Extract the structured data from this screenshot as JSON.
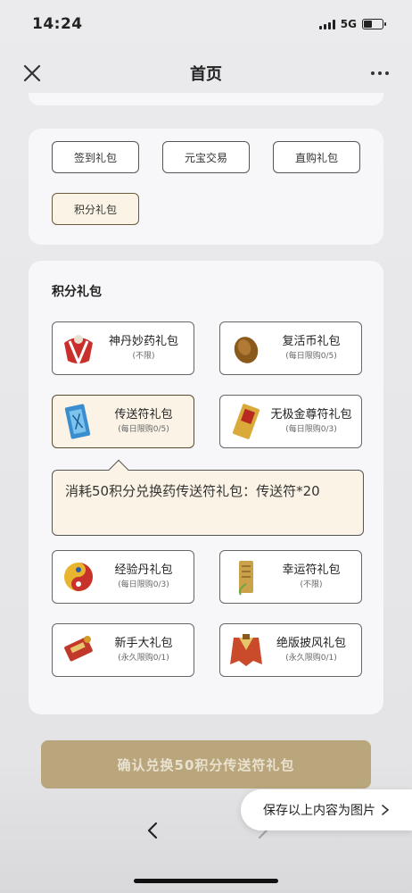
{
  "status_bar": {
    "time": "14:24",
    "network": "5G"
  },
  "nav": {
    "title": "首页"
  },
  "tabs": [
    {
      "label": "签到礼包",
      "active": false
    },
    {
      "label": "元宝交易",
      "active": false
    },
    {
      "label": "直购礼包",
      "active": false
    },
    {
      "label": "积分礼包",
      "active": true
    }
  ],
  "section": {
    "title": "积分礼包"
  },
  "gifts": [
    {
      "name": "神丹妙药礼包",
      "limit": "(不限)",
      "icon": "red-pill-package-icon"
    },
    {
      "name": "复活币礼包",
      "limit": "(每日限购0/5)",
      "icon": "revive-coin-icon"
    },
    {
      "name": "传送符礼包",
      "limit": "(每日限购0/5)",
      "icon": "teleport-charm-icon",
      "selected": true
    },
    {
      "name": "无极金尊符礼包",
      "limit": "(每日限购0/3)",
      "icon": "golden-talisman-icon"
    },
    {
      "name": "经验丹礼包",
      "limit": "(每日限购0/3)",
      "icon": "exp-pill-icon"
    },
    {
      "name": "幸运符礼包",
      "limit": "(不限)",
      "icon": "luck-charm-icon"
    },
    {
      "name": "新手大礼包",
      "limit": "(永久限购0/1)",
      "icon": "newbie-pack-icon"
    },
    {
      "name": "绝版披风礼包",
      "limit": "(永久限购0/1)",
      "icon": "cape-icon"
    }
  ],
  "tooltip": {
    "text": "消耗50积分兑换药传送符礼包：传送符*20"
  },
  "confirm": {
    "label": "确认兑换50积分传送符礼包"
  },
  "save_image": {
    "label": "保存以上内容为图片"
  }
}
